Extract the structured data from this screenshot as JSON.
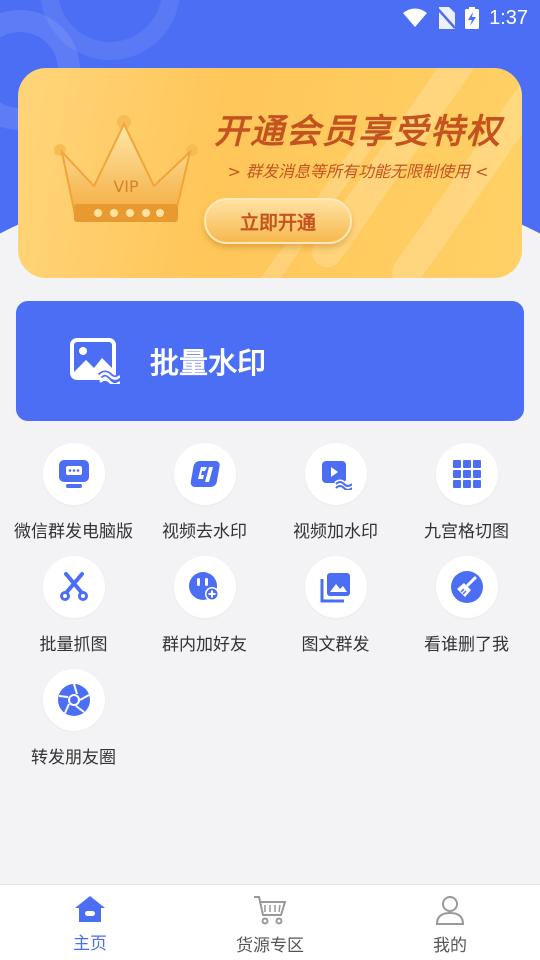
{
  "status_bar": {
    "time": "1:37"
  },
  "vip_banner": {
    "title": "开通会员享受特权",
    "subtitle": "> 群发消息等所有功能无限制使用 <",
    "crown_text": "VIP",
    "button_label": "立即开通"
  },
  "batch_watermark": {
    "label": "批量水印",
    "icon": "image-wave-icon"
  },
  "tools": [
    {
      "label": "微信群发电脑版",
      "icon": "monitor-chat-icon"
    },
    {
      "label": "视频去水印",
      "icon": "video-remove-watermark-icon"
    },
    {
      "label": "视频加水印",
      "icon": "video-add-watermark-icon"
    },
    {
      "label": "九宫格切图",
      "icon": "grid-nine-icon"
    },
    {
      "label": "批量抓图",
      "icon": "scissors-icon"
    },
    {
      "label": "群内加好友",
      "icon": "group-add-friend-icon"
    },
    {
      "label": "图文群发",
      "icon": "image-gallery-icon"
    },
    {
      "label": "看谁删了我",
      "icon": "broom-icon"
    },
    {
      "label": "转发朋友圈",
      "icon": "aperture-icon"
    }
  ],
  "bottom_nav": [
    {
      "label": "主页",
      "icon": "home-icon",
      "active": true
    },
    {
      "label": "货源专区",
      "icon": "cart-icon",
      "active": false
    },
    {
      "label": "我的",
      "icon": "user-icon",
      "active": false
    }
  ],
  "colors": {
    "primary": "#4b6ef5",
    "vip_text": "#c4541f",
    "vip_gold": "#ffd166"
  }
}
